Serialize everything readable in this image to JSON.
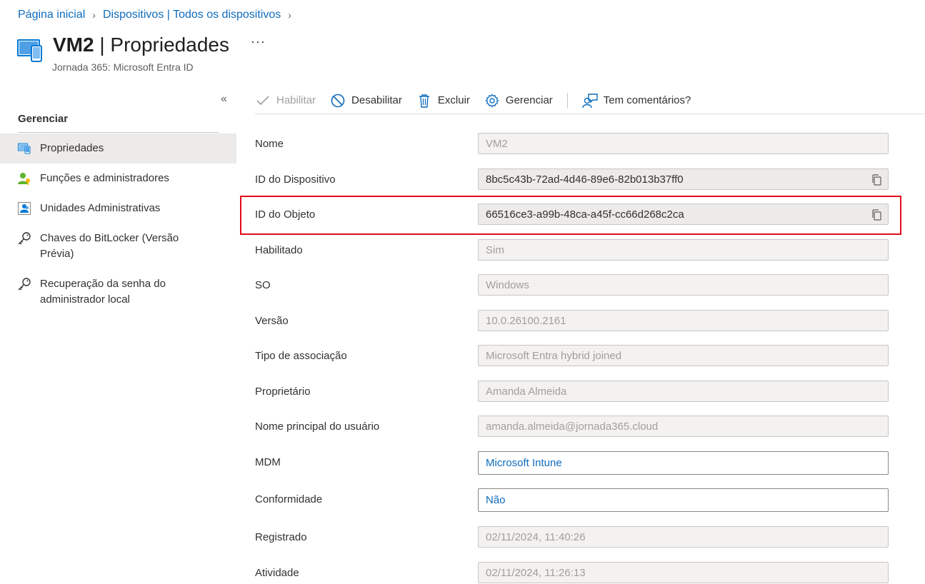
{
  "breadcrumb": {
    "home": "Página inicial",
    "devices": "Dispositivos | Todos os dispositivos",
    "sep": "›"
  },
  "header": {
    "title_bold": "VM2",
    "title_rest": " | Propriedades",
    "more": "···",
    "subtitle": "Jornada 365: Microsoft Entra ID"
  },
  "sidebar": {
    "collapse": "«",
    "section": "Gerenciar",
    "items": [
      {
        "label": "Propriedades",
        "icon": "device-icon"
      },
      {
        "label": "Funções e administradores",
        "icon": "person-icon"
      },
      {
        "label": "Unidades Administrativas",
        "icon": "admin-unit-icon"
      },
      {
        "label": "Chaves do BitLocker (Versão Prévia)",
        "icon": "key-icon"
      },
      {
        "label": "Recuperação da senha do administrador local",
        "icon": "key-icon"
      }
    ]
  },
  "toolbar": {
    "enable": "Habilitar",
    "disable": "Desabilitar",
    "delete": "Excluir",
    "manage": "Gerenciar",
    "feedback": "Tem comentários?"
  },
  "properties": {
    "name": {
      "label": "Nome",
      "value": "VM2"
    },
    "device_id": {
      "label": "ID do Dispositivo",
      "value": "8bc5c43b-72ad-4d46-89e6-82b013b37ff0"
    },
    "object_id": {
      "label": "ID do Objeto",
      "value": "66516ce3-a99b-48ca-a45f-cc66d268c2ca"
    },
    "enabled": {
      "label": "Habilitado",
      "value": "Sim"
    },
    "os": {
      "label": "SO",
      "value": "Windows"
    },
    "version": {
      "label": "Versão",
      "value": "10.0.26100.2161"
    },
    "join_type": {
      "label": "Tipo de associação",
      "value": "Microsoft Entra hybrid joined"
    },
    "owner": {
      "label": "Proprietário",
      "value": "Amanda Almeida"
    },
    "upn": {
      "label": "Nome principal do usuário",
      "value": "amanda.almeida@jornada365.cloud"
    },
    "mdm": {
      "label": "MDM",
      "value": "Microsoft Intune"
    },
    "compliance": {
      "label": "Conformidade",
      "value": "Não"
    },
    "registered": {
      "label": "Registrado",
      "value": "02/11/2024, 11:40:26"
    },
    "activity": {
      "label": "Atividade",
      "value": "02/11/2024, 11:26:13"
    }
  },
  "colors": {
    "link": "#0f6cbd",
    "highlight": "#e00b1c",
    "active_item": "#edebe9"
  }
}
